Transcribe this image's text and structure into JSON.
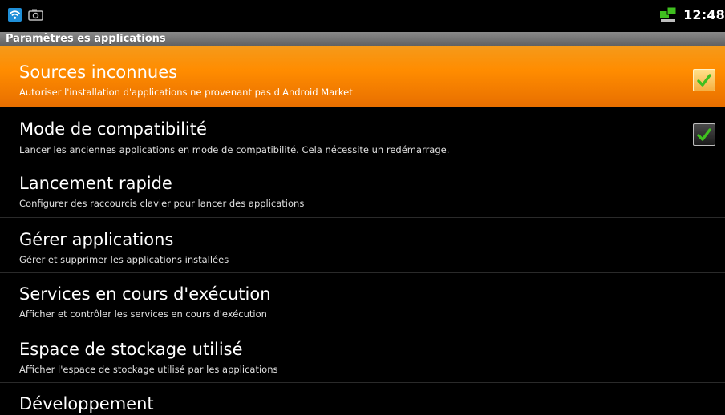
{
  "status_bar": {
    "time": "12:48",
    "icons": [
      "wifi-icon",
      "camera-icon",
      "network-sync-icon"
    ]
  },
  "title_bar": {
    "title": "Paramètres es applications"
  },
  "colors": {
    "selected_row": "#ff8c00",
    "checkmark": "#3fbf1f",
    "background": "#000000"
  },
  "settings": [
    {
      "title": "Sources inconnues",
      "summary": "Autoriser l'installation d'applications ne provenant pas d'Android Market",
      "checkbox": true,
      "checked": true,
      "selected": true
    },
    {
      "title": "Mode de compatibilité",
      "summary": "Lancer les anciennes applications en mode de compatibilité. Cela nécessite un redémarrage.",
      "checkbox": true,
      "checked": true,
      "selected": false
    },
    {
      "title": "Lancement rapide",
      "summary": "Configurer des raccourcis clavier pour lancer des applications",
      "checkbox": false,
      "selected": false
    },
    {
      "title": "Gérer applications",
      "summary": "Gérer et supprimer les applications installées",
      "checkbox": false,
      "selected": false
    },
    {
      "title": "Services en cours d'exécution",
      "summary": "Afficher et contrôler les services en cours d'exécution",
      "checkbox": false,
      "selected": false
    },
    {
      "title": "Espace de stockage utilisé",
      "summary": "Afficher l'espace de stockage utilisé par les applications",
      "checkbox": false,
      "selected": false
    },
    {
      "title": "Développement",
      "summary": "",
      "checkbox": false,
      "selected": false
    }
  ]
}
